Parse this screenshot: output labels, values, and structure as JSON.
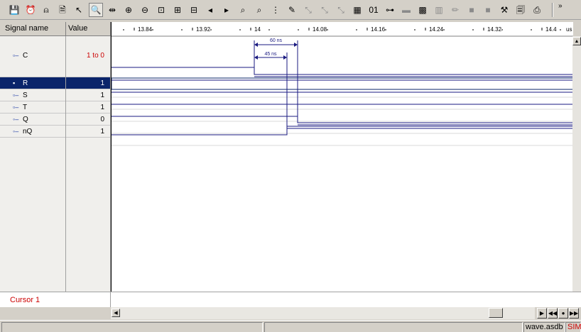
{
  "toolbar": {
    "buttons": [
      {
        "icon": "save-icon",
        "glyph": "💾"
      },
      {
        "icon": "alarm-clock-icon",
        "glyph": "⏰"
      },
      {
        "icon": "stimulator-icon",
        "glyph": "⍝"
      },
      {
        "icon": "properties-icon",
        "glyph": "🗎"
      },
      {
        "icon": "pointer-icon",
        "glyph": "↖"
      },
      {
        "icon": "zoom-mode-icon",
        "glyph": "🔍"
      },
      {
        "icon": "measure-icon",
        "glyph": "⇹"
      },
      {
        "icon": "zoom-in-icon",
        "glyph": "⊕"
      },
      {
        "icon": "zoom-out-icon",
        "glyph": "⊖"
      },
      {
        "icon": "zoom-fit-icon",
        "glyph": "⊡"
      },
      {
        "icon": "zoom-range-icon",
        "glyph": "⊞"
      },
      {
        "icon": "zoom-previous-icon",
        "glyph": "⊟"
      },
      {
        "icon": "previous-edge-icon",
        "glyph": "◂"
      },
      {
        "icon": "next-edge-icon",
        "glyph": "▸"
      },
      {
        "icon": "find-backward-icon",
        "glyph": "⌕"
      },
      {
        "icon": "find-forward-icon",
        "glyph": "⌕"
      },
      {
        "icon": "footprints-icon",
        "glyph": "⋮"
      },
      {
        "icon": "draw-icon",
        "glyph": "✎"
      },
      {
        "icon": "disabled-tool-1-icon",
        "glyph": "⤡"
      },
      {
        "icon": "disabled-tool-2-icon",
        "glyph": "⤡"
      },
      {
        "icon": "disabled-tool-3-icon",
        "glyph": "⤡"
      },
      {
        "icon": "add-signal-icon",
        "glyph": "▦"
      },
      {
        "icon": "binary-display-icon",
        "glyph": "01"
      },
      {
        "icon": "hierarchy-icon",
        "glyph": "⊶"
      },
      {
        "icon": "disabled-tool-4-icon",
        "glyph": "▬"
      },
      {
        "icon": "grid-icon",
        "glyph": "▩"
      },
      {
        "icon": "disabled-tool-5-icon",
        "glyph": "▥"
      },
      {
        "icon": "disabled-tool-6-icon",
        "glyph": "✏"
      },
      {
        "icon": "disabled-tool-7-icon",
        "glyph": "■"
      },
      {
        "icon": "disabled-tool-8-icon",
        "glyph": "■"
      },
      {
        "icon": "transform-icon",
        "glyph": "⚒"
      },
      {
        "icon": "print-preview-icon",
        "glyph": "🗐"
      },
      {
        "icon": "print-icon",
        "glyph": "⎙"
      }
    ],
    "more": "»"
  },
  "headers": {
    "signal_name": "Signal name",
    "value": "Value"
  },
  "time_axis": {
    "ticks": [
      "13.84",
      "13.92",
      "14",
      "14.08",
      "14.16",
      "14.24",
      "14.32",
      "14.4"
    ],
    "unit": "us"
  },
  "signals": [
    {
      "name": "C",
      "value": "1 to 0",
      "value_color": "#cc0000",
      "selected": false,
      "icon": "input-port-icon"
    },
    {
      "name": "R",
      "value": "1",
      "value_color": "#000000",
      "selected": true,
      "icon": "input-port-icon"
    },
    {
      "name": "S",
      "value": "1",
      "value_color": "#000000",
      "selected": false,
      "icon": "input-port-icon"
    },
    {
      "name": "T",
      "value": "1",
      "value_color": "#000000",
      "selected": false,
      "icon": "input-port-icon"
    },
    {
      "name": "Q",
      "value": "0",
      "value_color": "#000000",
      "selected": false,
      "icon": "output-port-icon"
    },
    {
      "name": "nQ",
      "value": "1",
      "value_color": "#000000",
      "selected": false,
      "icon": "output-port-icon"
    }
  ],
  "measurements": [
    {
      "label": "60 ns"
    },
    {
      "label": "45 ns"
    }
  ],
  "cursor": {
    "label": "Cursor 1"
  },
  "status": {
    "filename": "wave.asdb",
    "mode": "SIM"
  },
  "colors": {
    "wave": "#1a1a80",
    "selection": "#0a246a",
    "value_changed": "#cc0000"
  }
}
